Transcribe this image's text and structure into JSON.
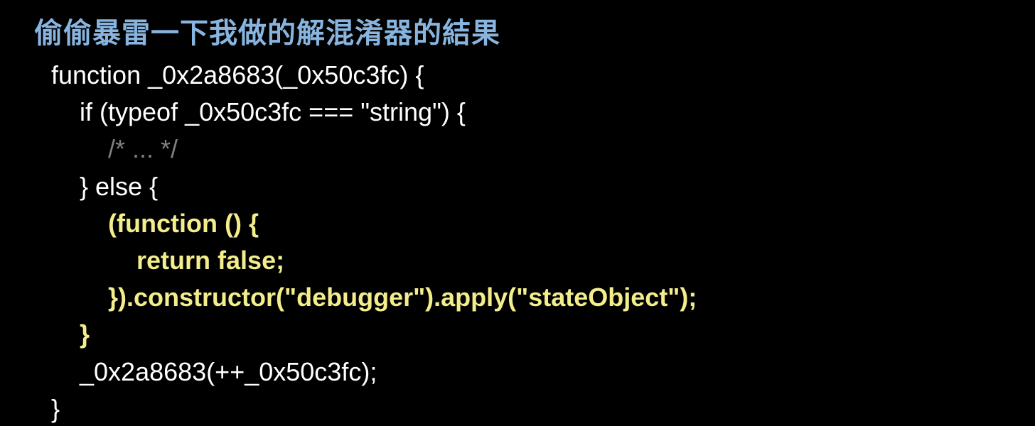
{
  "title": "偷偷暴雷一下我做的解混淆器的結果",
  "code": {
    "l1": "function _0x2a8683(_0x50c3fc) {",
    "l2": "    if (typeof _0x50c3fc === \"string\") {",
    "l3": "        /* ... */",
    "l4": "    } else {",
    "l5": "        (function () {",
    "l6": "            return false;",
    "l7": "        }).constructor(\"debugger\").apply(\"stateObject\");",
    "l8": "    }",
    "l9": "    _0x2a8683(++_0x50c3fc);",
    "l10": "}"
  },
  "colors": {
    "background": "#000000",
    "title": "#88b5e0",
    "text": "#ffffff",
    "comment": "#808080",
    "highlight": "#f3ee8b"
  }
}
